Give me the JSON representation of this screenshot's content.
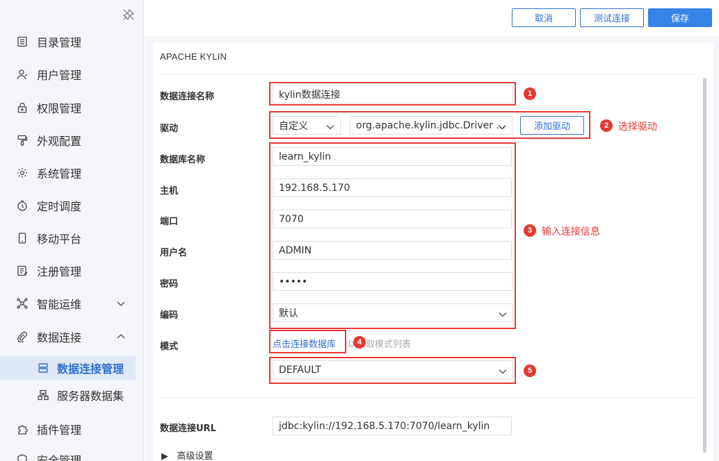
{
  "sidebar": {
    "items": [
      {
        "label": "目录管理",
        "icon": "catalog-icon"
      },
      {
        "label": "用户管理",
        "icon": "user-icon"
      },
      {
        "label": "权限管理",
        "icon": "lock-icon"
      },
      {
        "label": "外观配置",
        "icon": "brush-icon"
      },
      {
        "label": "系统管理",
        "icon": "gear-icon"
      },
      {
        "label": "定时调度",
        "icon": "clock-icon"
      },
      {
        "label": "移动平台",
        "icon": "mobile-icon"
      },
      {
        "label": "注册管理",
        "icon": "register-icon"
      },
      {
        "label": "智能运维",
        "icon": "network-icon"
      },
      {
        "label": "数据连接",
        "icon": "link-icon"
      }
    ],
    "sub_items": [
      {
        "label": "数据连接管理",
        "icon": "database-icon",
        "active": true
      },
      {
        "label": "服务器数据集",
        "icon": "server-dataset-icon",
        "active": false
      }
    ],
    "bottom_items": [
      {
        "label": "插件管理",
        "icon": "plugin-icon"
      },
      {
        "label": "安全管理",
        "icon": "security-icon"
      }
    ]
  },
  "toolbar": {
    "cancel_label": "取消",
    "test_label": "测试连接",
    "save_label": "保存"
  },
  "panel": {
    "title": "APACHE KYLIN"
  },
  "form": {
    "name_label": "数据连接名称",
    "name_value": "kylin数据连接",
    "driver_label": "驱动",
    "driver_type": "自定义",
    "driver_class": "org.apache.kylin.jdbc.Driver ...",
    "add_driver_label": "添加驱动",
    "db_label": "数据库名称",
    "db_value": "learn_kylin",
    "host_label": "主机",
    "host_value": "192.168.5.170",
    "port_label": "端口",
    "port_value": "7070",
    "user_label": "用户名",
    "user_value": "ADMIN",
    "password_label": "密码",
    "password_value": "•••••",
    "encoding_label": "编码",
    "encoding_value": "默认",
    "schema_label": "模式",
    "connect_link": "点击连接数据库",
    "schema_hint": "以获取模式列表",
    "schema_value": "DEFAULT",
    "url_label": "数据连接URL",
    "url_value": "jdbc:kylin://192.168.5.170:7070/learn_kylin",
    "advanced_label": "高级设置"
  },
  "annotations": {
    "badges": [
      "1",
      "2",
      "3",
      "4",
      "5"
    ],
    "notes": {
      "driver": "选择驱动",
      "info": "输入连接信息"
    },
    "color": "#e53935"
  },
  "colors": {
    "accent": "#2f6fd0",
    "primary_button": "#3684e8",
    "sidebar_bg": "#f4f6f9",
    "active_bg": "#dfe9f6"
  }
}
